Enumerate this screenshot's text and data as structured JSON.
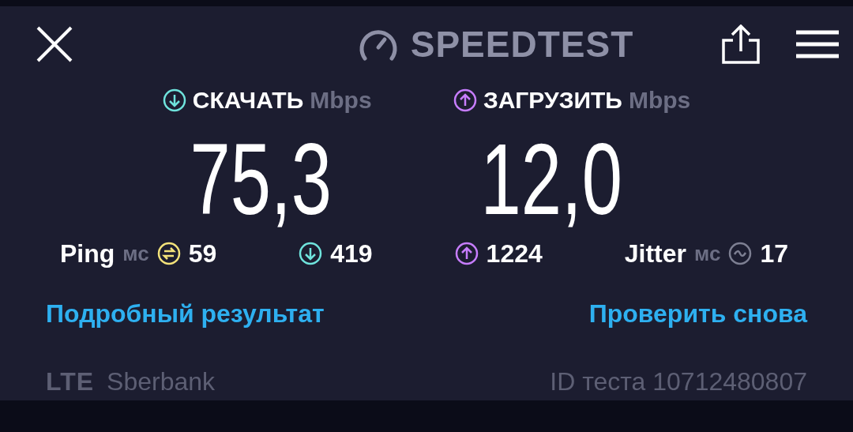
{
  "header": {
    "title": "SPEEDTEST"
  },
  "results": [
    {
      "kind": "download",
      "label": "СКАЧАТЬ",
      "unit": "Mbps",
      "value": "75,3",
      "color": "#6fe3dc"
    },
    {
      "kind": "upload",
      "label": "ЗАГРУЗИТЬ",
      "unit": "Mbps",
      "value": "12,0",
      "color": "#c77dff"
    }
  ],
  "stats": [
    {
      "kind": "ping",
      "label": "Ping",
      "unit": "мс",
      "value": "59",
      "color": "#f3e27a"
    },
    {
      "kind": "download",
      "value": "419",
      "color": "#6fe3dc"
    },
    {
      "kind": "upload",
      "value": "1224",
      "color": "#c77dff"
    },
    {
      "kind": "jitter",
      "label": "Jitter",
      "unit": "мс",
      "value": "17",
      "color": "#7d7f92"
    }
  ],
  "links": [
    "Подробный результат",
    "Проверить снова"
  ],
  "footer": {
    "network": "LTE",
    "provider": "Sberbank",
    "test_id": "ID теста 10712480807"
  }
}
